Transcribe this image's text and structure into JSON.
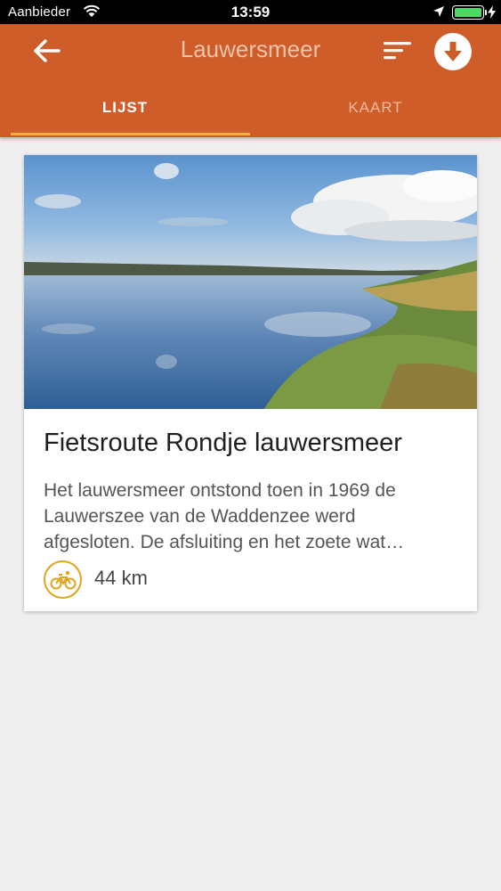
{
  "status_bar": {
    "carrier": "Aanbieder",
    "time": "13:59",
    "icons": [
      "wifi-icon",
      "location-arrow-icon",
      "battery-icon",
      "charging-bolt-icon"
    ],
    "battery_level": 1.0,
    "battery_color": "#4cd964"
  },
  "app_bar": {
    "title": "Lauwersmeer",
    "back_icon": "arrow-left-icon",
    "sort_icon": "sort-icon",
    "download_icon": "download-circle-icon",
    "background_color": "#cf5d2a"
  },
  "tabs": [
    {
      "label": "LIJST",
      "selected": true
    },
    {
      "label": "KAART",
      "selected": false
    }
  ],
  "routes": [
    {
      "title": "Fietsroute Rondje lauwersmeer",
      "description_lines": [
        "Het lauwersmeer ontstond toen in 1969 de",
        "Lauwerszee van de Waddenzee werd",
        "afgesloten. De afsluiting en het zoete wat…"
      ],
      "type_icon": "bicycle-icon",
      "distance": "44 km",
      "image": "lake-landscape-photo"
    }
  ],
  "accent_color": "#f0b23e"
}
